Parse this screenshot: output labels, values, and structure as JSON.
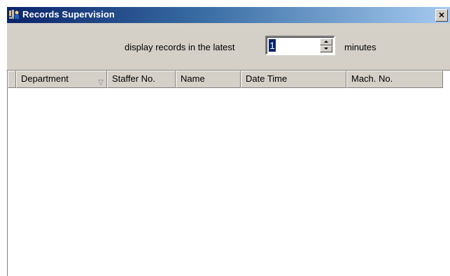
{
  "window": {
    "title": "Records Supervision",
    "close_label": "×",
    "icon": "app-records-icon"
  },
  "toolbar": {
    "prefix_label": "display records in the latest",
    "minutes_value": "1",
    "suffix_label": "minutes",
    "spin_up_icon": "spin-up-arrow-icon",
    "spin_down_icon": "spin-down-arrow-icon"
  },
  "grid": {
    "columns": [
      {
        "key": "department",
        "label": "Department",
        "sortable": true
      },
      {
        "key": "staffer_no",
        "label": "Staffer No."
      },
      {
        "key": "name",
        "label": "Name"
      },
      {
        "key": "date_time",
        "label": "Date Time"
      },
      {
        "key": "mach_no",
        "label": "Mach. No."
      }
    ],
    "sort_icon": "▽",
    "rows": []
  },
  "colors": {
    "title_gradient_start": "#0a246a",
    "title_gradient_end": "#a6caf0",
    "face": "#d4d0c8",
    "selection": "#0a246a"
  }
}
